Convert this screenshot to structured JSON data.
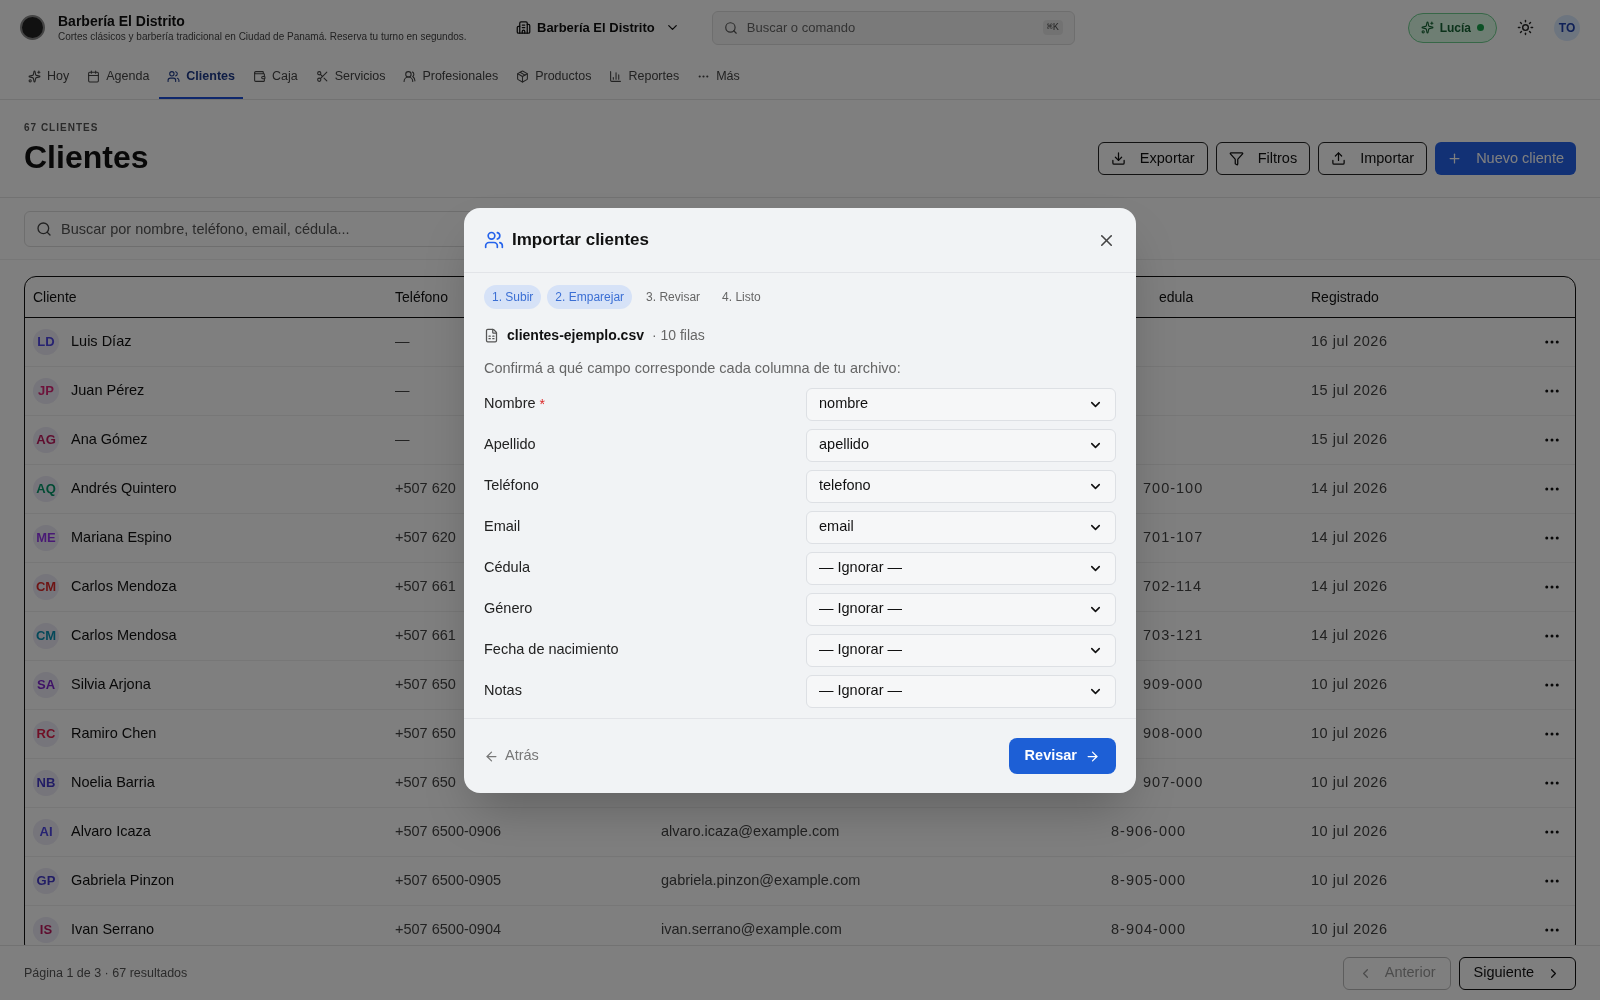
{
  "header": {
    "title": "Barbería El Distrito",
    "subtitle": "Cortes clásicos y barbería tradicional en Ciudad de Panamá. Reserva tu turno en segundos.",
    "branch": "Barbería El Distrito",
    "search": {
      "placeholder": "Buscar o comando",
      "shortcut": "⌘K"
    },
    "assistant": {
      "label": "Lucía",
      "online": true
    },
    "user_initials": "TO"
  },
  "tabs": [
    {
      "label": "Hoy",
      "selected": false
    },
    {
      "label": "Agenda",
      "selected": false
    },
    {
      "label": "Clientes",
      "selected": true
    },
    {
      "label": "Caja",
      "selected": false
    },
    {
      "label": "Servicios",
      "selected": false
    },
    {
      "label": "Profesionales",
      "selected": false
    },
    {
      "label": "Productos",
      "selected": false
    },
    {
      "label": "Reportes",
      "selected": false
    },
    {
      "label": "Más",
      "selected": false
    }
  ],
  "page": {
    "count": "67 CLIENTES",
    "title": "Clientes",
    "actions": [
      {
        "label": "Exportar",
        "kind": "export"
      },
      {
        "label": "Filtros",
        "kind": "filter"
      },
      {
        "label": "Importar",
        "kind": "import"
      },
      {
        "label": "Nuevo cliente",
        "kind": "primary"
      }
    ],
    "search": {
      "placeholder": "Buscar por nombre, teléfono, email, cédula..."
    }
  },
  "table": {
    "columns": [
      "Cliente",
      "Teléfono",
      "edula",
      "Registrado"
    ],
    "rows": [
      {
        "initials": "LD",
        "color": "#272372",
        "name": "Luis Díaz",
        "phone": "—",
        "registered": "16 jul 2026"
      },
      {
        "initials": "JP",
        "color": "#6d133b",
        "name": "Juan Pérez",
        "phone": "—",
        "registered": "15 jul 2026"
      },
      {
        "initials": "AG",
        "color": "#5f0c2e",
        "name": "Ana Gómez",
        "phone": "—",
        "registered": "15 jul 2026"
      },
      {
        "initials": "AQ",
        "color": "#024b34",
        "name": "Andrés Quintero",
        "phone": "+507 620",
        "cedula": "700-100",
        "registered": "14 jul 2026"
      },
      {
        "initials": "ME",
        "color": "#491975",
        "name": "Mariana Espino",
        "phone": "+507 620",
        "cedula": "701-107",
        "registered": "14 jul 2026"
      },
      {
        "initials": "CM",
        "color": "#6e1313",
        "name": "Carlos Mendoza",
        "phone": "+507 661",
        "cedula": "702-114",
        "registered": "14 jul 2026"
      },
      {
        "initials": "CM",
        "color": "#044859",
        "name": "Carlos Mendosa",
        "phone": "+507 661",
        "cedula": "703-121",
        "registered": "14 jul 2026"
      },
      {
        "initials": "SA",
        "color": "#3f1167",
        "name": "Silvia Arjona",
        "phone": "+507 650",
        "cedula": "909-000",
        "registered": "10 jul 2026"
      },
      {
        "initials": "RC",
        "color": "#700e24",
        "name": "Ramiro Chen",
        "phone": "+507 650",
        "cedula": "908-000",
        "registered": "10 jul 2026"
      },
      {
        "initials": "NB",
        "color": "#211c65",
        "name": "Noelia Barria",
        "phone": "+507 650",
        "cedula": "907-000",
        "registered": "10 jul 2026"
      },
      {
        "initials": "AI",
        "color": "#272372",
        "name": "Alvaro Icaza",
        "phone": "+507 6500-0906",
        "email": "alvaro.icaza@example.com",
        "cedula": "8-906-000",
        "registered": "10 jul 2026"
      },
      {
        "initials": "GP",
        "color": "#211c65",
        "name": "Gabriela Pinzon",
        "phone": "+507 6500-0905",
        "email": "gabriela.pinzon@example.com",
        "cedula": "8-905-000",
        "registered": "10 jul 2026"
      },
      {
        "initials": "IS",
        "color": "#5f0c2e",
        "name": "Ivan Serrano",
        "phone": "+507 6500-0904",
        "email": "ivan.serrano@example.com",
        "cedula": "8-904-000",
        "registered": "10 jul 2026"
      }
    ]
  },
  "pagination": {
    "summary": "Página 1 de 3 · 67 resultados",
    "previous": {
      "label": "Anterior",
      "disabled": true
    },
    "next": {
      "label": "Siguiente",
      "disabled": false
    }
  },
  "dialog": {
    "title": "Importar clientes",
    "steps": [
      {
        "label": "1. Subir",
        "active": true
      },
      {
        "label": "2. Emparejar",
        "active": true
      },
      {
        "label": "3. Revisar",
        "active": false
      },
      {
        "label": "4. Listo",
        "active": false
      }
    ],
    "file": {
      "name": "clientes-ejemplo.csv",
      "rows": "· 10 filas"
    },
    "required_marker": "*",
    "instruction": "Confirmá a qué campo corresponde cada columna de tu archivo:",
    "mappings": [
      {
        "label": "Nombre",
        "required": true,
        "value": "nombre"
      },
      {
        "label": "Apellido",
        "required": false,
        "value": "apellido"
      },
      {
        "label": "Teléfono",
        "required": false,
        "value": "telefono"
      },
      {
        "label": "Email",
        "required": false,
        "value": "email"
      },
      {
        "label": "Cédula",
        "required": false,
        "value": "— Ignorar —"
      },
      {
        "label": "Género",
        "required": false,
        "value": "— Ignorar —"
      },
      {
        "label": "Fecha de nacimiento",
        "required": false,
        "value": "— Ignorar —"
      },
      {
        "label": "Notas",
        "required": false,
        "value": "— Ignorar —"
      }
    ],
    "back": "Atrás",
    "next": "Revisar"
  }
}
